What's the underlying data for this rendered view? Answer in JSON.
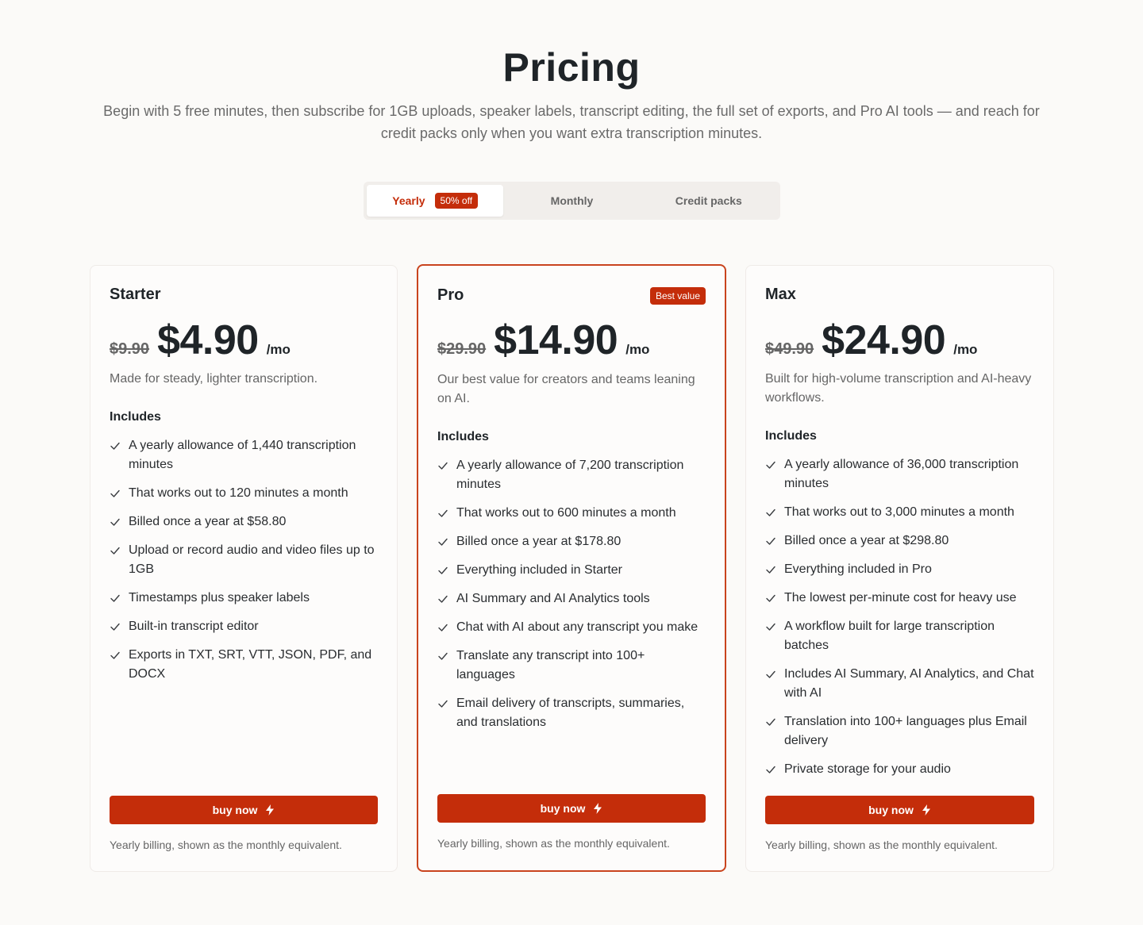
{
  "page": {
    "title": "Pricing",
    "subtitle": "Begin with 5 free minutes, then subscribe for 1GB uploads, speaker labels, transcript editing, the full set of exports, and Pro AI tools — and reach for credit packs only when you want extra transcription minutes."
  },
  "toggle": {
    "yearly": "Yearly",
    "discount": "50% off",
    "monthly": "Monthly",
    "credit_packs": "Credit packs"
  },
  "colors": {
    "accent": "#c42d0a",
    "background": "#fbfaf8"
  },
  "plans": [
    {
      "name": "Starter",
      "old_price": "$9.90",
      "price": "$4.90",
      "unit": "/mo",
      "description": "Made for steady, lighter transcription.",
      "includes_label": "Includes",
      "features": [
        "A yearly allowance of 1,440 transcription minutes",
        "That works out to 120 minutes a month",
        "Billed once a year at $58.80",
        "Upload or record audio and video files up to 1GB",
        "Timestamps plus speaker labels",
        "Built-in transcript editor",
        "Exports in TXT, SRT, VTT, JSON, PDF, and DOCX"
      ],
      "button": "buy now",
      "note": "Yearly billing, shown as the monthly equivalent."
    },
    {
      "name": "Pro",
      "badge": "Best value",
      "old_price": "$29.90",
      "price": "$14.90",
      "unit": "/mo",
      "description": "Our best value for creators and teams leaning on AI.",
      "includes_label": "Includes",
      "features": [
        "A yearly allowance of 7,200 transcription minutes",
        "That works out to 600 minutes a month",
        "Billed once a year at $178.80",
        "Everything included in Starter",
        "AI Summary and AI Analytics tools",
        "Chat with AI about any transcript you make",
        "Translate any transcript into 100+ languages",
        "Email delivery of transcripts, summaries, and translations"
      ],
      "button": "buy now",
      "note": "Yearly billing, shown as the monthly equivalent."
    },
    {
      "name": "Max",
      "old_price": "$49.90",
      "price": "$24.90",
      "unit": "/mo",
      "description": "Built for high-volume transcription and AI-heavy workflows.",
      "includes_label": "Includes",
      "features": [
        "A yearly allowance of 36,000 transcription minutes",
        "That works out to 3,000 minutes a month",
        "Billed once a year at $298.80",
        "Everything included in Pro",
        "The lowest per-minute cost for heavy use",
        "A workflow built for large transcription batches",
        "Includes AI Summary, AI Analytics, and Chat with AI",
        "Translation into 100+ languages plus Email delivery",
        "Private storage for your audio"
      ],
      "button": "buy now",
      "note": "Yearly billing, shown as the monthly equivalent."
    }
  ]
}
